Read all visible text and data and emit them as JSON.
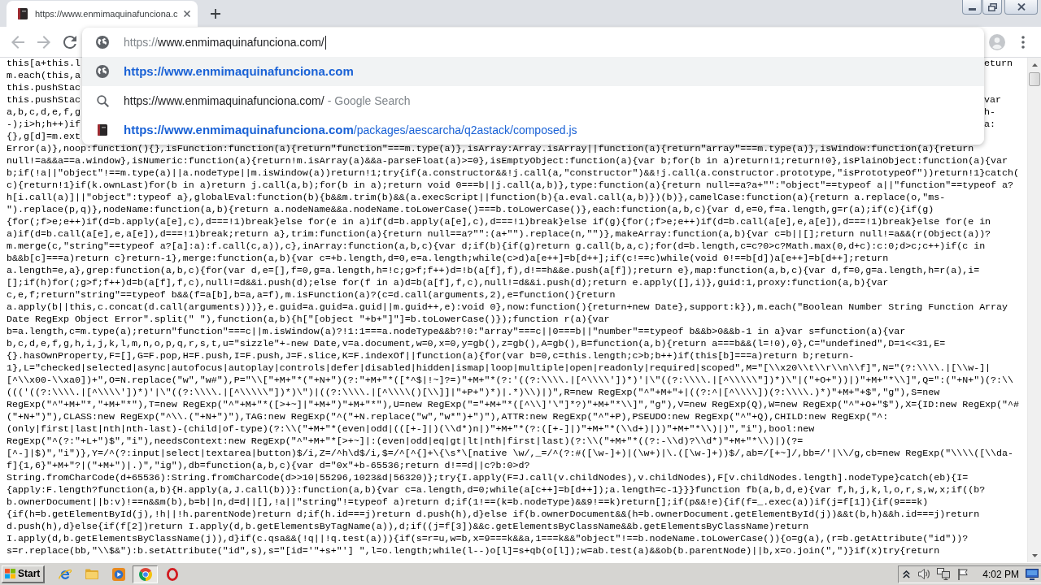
{
  "tabs": [
    {
      "title": "https://www.enmimaquinafunciona.c",
      "selected": true
    }
  ],
  "nav_buttons": [
    {
      "kind": "back",
      "disabled": true
    },
    {
      "kind": "forward",
      "disabled": true
    },
    {
      "kind": "reload",
      "disabled": false
    }
  ],
  "omnibox": {
    "scheme": "https://",
    "address": "www.enmimaquinafunciona.com/"
  },
  "suggestions": [
    {
      "kind": "url",
      "selected": true,
      "text": "https://www.enmimaquinafunciona.com"
    },
    {
      "kind": "search",
      "selected": false,
      "query": "https://www.enmimaquinafunciona.com/",
      "suffix": "- Google Search"
    },
    {
      "kind": "page",
      "selected": false,
      "host": "https://www.enmimaquinafunciona.com",
      "path": "/packages/aescarcha/q2astack/composed.js"
    }
  ],
  "covered_lines": [
    {
      "start": "this[a+this.l",
      "end": "eturn"
    },
    {
      "start": "m.each(this,a"
    },
    {
      "start": "this.pushStac"
    },
    {
      "start": "this.pushStac",
      "end": "var"
    },
    {
      "start": "a,b,c,d,e,f,g",
      "end": "h-"
    },
    {
      "start": "-);i>h;h++)if",
      "end": "a:"
    },
    {
      "start": "{},g[d]=m.ext"
    }
  ],
  "source_lines": [
    "Error(a)},noop:function(){},isFunction:function(a){return\"function\"===m.type(a)},isArray:Array.isArray||function(a){return\"array\"===m.type(a)},isWindow:function(a){return",
    "null!=a&&a==a.window},isNumeric:function(a){return!m.isArray(a)&&a-parseFloat(a)>=0},isEmptyObject:function(a){var b;for(b in a)return!1;return!0},isPlainObject:function(a){var",
    "b;if(!a||\"object\"!==m.type(a)||a.nodeType||m.isWindow(a))return!1;try{if(a.constructor&&!j.call(a,\"constructor\")&&!j.call(a.constructor.prototype,\"isPrototypeOf\"))return!1}catch(",
    "c){return!1}if(k.ownLast)for(b in a)return j.call(a,b);for(b in a);return void 0===b||j.call(a,b)},type:function(a){return null==a?a+\"\":\"object\"==typeof a||\"function\"==typeof a?",
    "h[i.call(a)]||\"object\":typeof a},globalEval:function(b){b&&m.trim(b)&&(a.execScript||function(b){a.eval.call(a,b)})(b)},camelCase:function(a){return a.replace(o,\"ms-",
    "\").replace(p,q)},nodeName:function(a,b){return a.nodeName&&a.nodeName.toLowerCase()===b.toLowerCase()},each:function(a,b,c){var d,e=0,f=a.length,g=r(a);if(c){if(g)",
    "{for(;f>e;e++)if(d=b.apply(a[e],c),d===!1)break}else for(e in a)if(d=b.apply(a[e],c),d===!1)break}else if(g){for(;f>e;e++)if(d=b.call(a[e],e,a[e]),d===!1)break}else for(e in",
    "a)if(d=b.call(a[e],e,a[e]),d===!1)break;return a},trim:function(a){return null==a?\"\":(a+\"\").replace(n,\"\")},makeArray:function(a,b){var c=b||[];return null!=a&&(r(Object(a))?",
    "m.merge(c,\"string\"==typeof a?[a]:a):f.call(c,a)),c},inArray:function(a,b,c){var d;if(b){if(g)return g.call(b,a,c);for(d=b.length,c=c?0>c?Math.max(0,d+c):c:0;d>c;c++)if(c in",
    "b&&b[c]===a)return c}return-1},merge:function(a,b){var c=+b.length,d=0,e=a.length;while(c>d)a[e++]=b[d++];if(c!==c)while(void 0!==b[d])a[e++]=b[d++];return",
    "a.length=e,a},grep:function(a,b,c){for(var d,e=[],f=0,g=a.length,h=!c;g>f;f++)d=!b(a[f],f),d!==h&&e.push(a[f]);return e},map:function(a,b,c){var d,f=0,g=a.length,h=r(a),i=",
    "[];if(h)for(;g>f;f++)d=b(a[f],f,c),null!=d&&i.push(d);else for(f in a)d=b(a[f],f,c),null!=d&&i.push(d);return e.apply([],i)},guid:1,proxy:function(a,b){var",
    "c,e,f;return\"string\"==typeof b&&(f=a[b],b=a,a=f),m.isFunction(a)?(c=d.call(arguments,2),e=function(){return",
    "a.apply(b||this,c.concat(d.call(arguments)))},e.guid=a.guid=a.guid||m.guid++,e):void 0},now:function(){return+new Date},support:k}),m.each(\"Boolean Number String Function Array",
    "Date RegExp Object Error\".split(\" \"),function(a,b){h[\"[object \"+b+\"]\"]=b.toLowerCase()});function r(a){var",
    "b=a.length,c=m.type(a);return\"function\"===c||m.isWindow(a)?!1:1===a.nodeType&&b?!0:\"array\"===c||0===b||\"number\"==typeof b&&b>0&&b-1 in a}var s=function(a){var",
    "b,c,d,e,f,g,h,i,j,k,l,m,n,o,p,q,r,s,t,u=\"sizzle\"+-new Date,v=a.document,w=0,x=0,y=gb(),z=gb(),A=gb(),B=function(a,b){return a===b&&(l=!0),0},C=\"undefined\",D=1<<31,E=",
    "{}.hasOwnProperty,F=[],G=F.pop,H=F.push,I=F.push,J=F.slice,K=F.indexOf||function(a){for(var b=0,c=this.length;c>b;b++)if(this[b]===a)return b;return-",
    "1},L=\"checked|selected|async|autofocus|autoplay|controls|defer|disabled|hidden|ismap|loop|multiple|open|readonly|required|scoped\",M=\"[\\\\x20\\\\t\\\\r\\\\n\\\\f]\",N=\"(?:\\\\\\\\.|[\\\\w-]|",
    "[^\\\\x00-\\\\xa0])+\",O=N.replace(\"w\",\"w#\"),P=\"\\\\[\"+M+\"*(\"+N+\")(?:\"+M+\"*([*^$|!~]?=)\"+M+\"*(?:'((?:\\\\\\\\.|[^\\\\\\\\'])*)'|\\\"((?:\\\\\\\\.|[^\\\\\\\\\\\"])*)\\\"|(\"+O+\"))|)\"+M+\"*\\\\]\",Q=\":(\"+N+\")(?:\\\\",
    "((('((?:\\\\\\\\.|[^\\\\\\\\'])*)'|\\\"((?:\\\\\\\\.|[^\\\\\\\\\\\"])*)\\\")|((?:\\\\\\\\.|[^\\\\\\\\()[\\\\]]|\"+P+\")*)|.*)\\\\)|)\",R=new RegExp(\"^\"+M+\"+|((?:^|[^\\\\\\\\])(?:\\\\\\\\.)*)\"+M+\"+$\",\"g\"),S=new",
    "RegExp(\"^\"+M+\"*,\"+M+\"*\"),T=new RegExp(\"^\"+M+\"*([>+~]|\"+M+\")\"+M+\"*\"),U=new RegExp(\"=\"+M+\"*([^\\\\]'\\\"]*?)\"+M+\"*\\\\]\",\"g\"),V=new RegExp(Q),W=new RegExp(\"^\"+O+\"$\"),X={ID:new RegExp(\"^#",
    "(\"+N+\")\"),CLASS:new RegExp(\"^\\\\.(\"+N+\")\"),TAG:new RegExp(\"^(\"+N.replace(\"w\",\"w*\")+\")\"),ATTR:new RegExp(\"^\"+P),PSEUDO:new RegExp(\"^\"+Q),CHILD:new RegExp(\"^:",
    "(only|first|last|nth|nth-last)-(child|of-type)(?:\\\\(\"+M+\"*(even|odd|(([+-]|)(\\\\d*)n|)\"+M+\"*(?:([+-]|)\"+M+\"*(\\\\d+)|))\"+M+\"*\\\\)|)\",\"i\"),bool:new",
    "RegExp(\"^(?:\"+L+\")$\",\"i\"),needsContext:new RegExp(\"^\"+M+\"*[>+~]|:(even|odd|eq|gt|lt|nth|first|last)(?:\\\\(\"+M+\"*((?:-\\\\d)?\\\\d*)\"+M+\"*\\\\)|)(?=",
    "[^-]|$)\",\"i\")},Y=/^(?:input|select|textarea|button)$/i,Z=/^h\\d$/i,$=/^[^{]+\\{\\s*\\[native \\w/,_=/^(?:#([\\w-]+)|(\\w+)|\\.([\\w-]+))$/,ab=/[+~]/,bb=/'|\\\\/g,cb=new RegExp(\"\\\\\\\\([\\\\da-",
    "f]{1,6}\"+M+\"?|(\"+M+\")|.)\",\"ig\"),db=function(a,b,c){var d=\"0x\"+b-65536;return d!==d||c?b:0>d?",
    "String.fromCharCode(d+65536):String.fromCharCode(d>>10|55296,1023&d|56320)};try{I.apply(F=J.call(v.childNodes),v.childNodes),F[v.childNodes.length].nodeType}catch(eb){I=",
    "{apply:F.length?function(a,b){H.apply(a,J.call(b))}:function(a,b){var c=a.length,d=0;while(a[c++]=b[d++]);a.length=c-1}}}function fb(a,b,d,e){var f,h,j,k,l,o,r,s,w,x;if((b?",
    "b.ownerDocument||b:v)!==n&&m(b),b=b||n,d=d||[],!a||\"string\"!=typeof a)return d;if(1!==(k=b.nodeType)&&9!==k)return[];if(p&&!e){if(f=_.exec(a))if(j=f[1]){if(9===k)",
    "{if(h=b.getElementById(j),!h||!h.parentNode)return d;if(h.id===j)return d.push(h),d}else if(b.ownerDocument&&(h=b.ownerDocument.getElementById(j))&&t(b,h)&&h.id===j)return",
    "d.push(h),d}else{if(f[2])return I.apply(d,b.getElementsByTagName(a)),d;if((j=f[3])&&c.getElementsByClassName&&b.getElementsByClassName)return",
    "I.apply(d,b.getElementsByClassName(j)),d}if(c.qsa&&(!q||!q.test(a))){if(s=r=u,w=b,x=9===k&&a,1===k&&\"object\"!==b.nodeName.toLowerCase()){o=g(a),(r=b.getAttribute(\"id\"))?",
    "s=r.replace(bb,\"\\\\$&\"):b.setAttribute(\"id\",s),s=\"[id='\"+s+\"'] \",l=o.length;while(l--)o[l]=s+qb(o[l]);w=ab.test(a)&&ob(b.parentNode)||b,x=o.join(\",\")}if(x)try{return"
  ],
  "taskbar": {
    "start_label": "Start",
    "apps": [
      {
        "kind": "ie",
        "selected": false
      },
      {
        "kind": "explorer",
        "selected": false
      },
      {
        "kind": "media",
        "selected": false
      },
      {
        "kind": "chrome",
        "selected": true
      },
      {
        "kind": "ring",
        "selected": false
      }
    ],
    "clock": "4:02 PM"
  }
}
